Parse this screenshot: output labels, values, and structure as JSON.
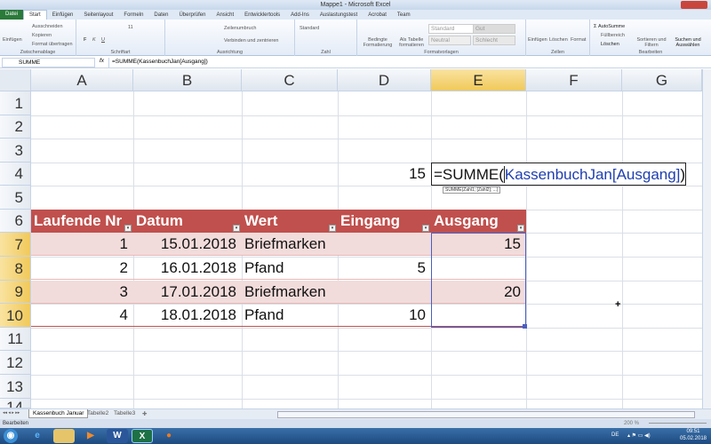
{
  "window": {
    "title": "Mappe1 - Microsoft Excel"
  },
  "tabs": [
    "Datei",
    "Start",
    "Einfügen",
    "Seitenlayout",
    "Formeln",
    "Daten",
    "Überprüfen",
    "Ansicht",
    "Entwicklertools",
    "Add-Ins",
    "Auslastungstest",
    "Acrobat",
    "Team"
  ],
  "ribbon": {
    "clipboard": {
      "paste": "Einfügen",
      "cut": "Ausschneiden",
      "copy": "Kopieren",
      "format_painter": "Format übertragen",
      "label": "Zwischenablage"
    },
    "font": {
      "size": "11",
      "label": "Schriftart",
      "bold": "F",
      "italic": "K",
      "underline": "U"
    },
    "alignment": {
      "wrap": "Zeilenumbruch",
      "merge": "Verbinden und zentrieren",
      "label": "Ausrichtung"
    },
    "number": {
      "format": "Standard",
      "label": "Zahl"
    },
    "styles": {
      "conditional": "Bedingte Formatierung",
      "as_table": "Als Tabelle formatieren",
      "standard": "Standard",
      "gut": "Gut",
      "neutral": "Neutral",
      "schlecht": "Schlecht",
      "label": "Formatvorlagen"
    },
    "cells": {
      "insert": "Einfügen",
      "delete": "Löschen",
      "format": "Format",
      "label": "Zellen"
    },
    "editing": {
      "autosum": "AutoSumme",
      "fill": "Füllbereich",
      "clear": "Löschen",
      "sort": "Sortieren und Filtern",
      "find": "Suchen und Auswählen",
      "label": "Bearbeiten"
    }
  },
  "formula_bar": {
    "name_box": "SUMME",
    "fx": "fx",
    "formula": "=SUMME(KassenbuchJan[Ausgang])"
  },
  "columns": [
    "A",
    "B",
    "C",
    "D",
    "E",
    "F",
    "G"
  ],
  "rows": [
    "1",
    "2",
    "3",
    "4",
    "5",
    "6",
    "7",
    "8",
    "9",
    "10",
    "11",
    "12",
    "13",
    "14"
  ],
  "sheet": {
    "d4": "15",
    "edit_prefix": "=SUMME(",
    "edit_ref": "KassenbuchJan[Ausgang]",
    "edit_suffix": ")",
    "tooltip": "SUMME(Zahl1; [Zahl2]; ...)",
    "table_headers": [
      "Laufende Nr",
      "Datum",
      "Wert",
      "Eingang",
      "Ausgang"
    ],
    "table_rows": [
      [
        "1",
        "15.01.2018",
        "Briefmarken",
        "",
        "15"
      ],
      [
        "2",
        "16.01.2018",
        "Pfand",
        "5",
        ""
      ],
      [
        "3",
        "17.01.2018",
        "Briefmarken",
        "",
        "20"
      ],
      [
        "4",
        "18.01.2018",
        "Pfand",
        "10",
        ""
      ]
    ]
  },
  "sheet_tabs": [
    "Kassenbuch Januar",
    "Tabelle2",
    "Tabelle3"
  ],
  "status": {
    "mode": "Bearbeiten",
    "zoom": "200 %"
  },
  "taskbar": {
    "lang": "DE",
    "time": "09:51",
    "date": "05.02.2018"
  },
  "colors": {
    "header": "#c0504d",
    "band": "#f2dcdb",
    "accent": "#1f4e9a"
  }
}
